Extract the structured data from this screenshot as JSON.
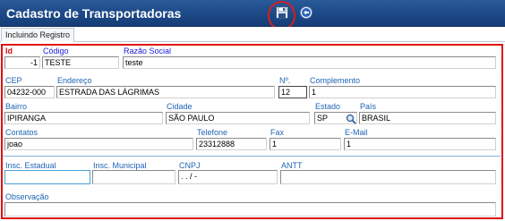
{
  "window": {
    "title": "Cadastro de Transportadoras",
    "save_icon": "save-disk-icon",
    "back_icon": "back-arrow-icon",
    "accent_color": "#1d4a88",
    "highlight_color": "#e01010"
  },
  "tab": {
    "label": "Incluindo Registro"
  },
  "form": {
    "id": {
      "label": "Id",
      "value": "-1"
    },
    "codigo": {
      "label": "Código",
      "value": "TESTE"
    },
    "razao_social": {
      "label": "Razão Social",
      "value": "teste"
    },
    "cep": {
      "label": "CEP",
      "value": "04232-000"
    },
    "endereco": {
      "label": "Endereço",
      "value": "ESTRADA DAS LÁGRIMAS"
    },
    "numero": {
      "label": "Nº.",
      "value": "12"
    },
    "complemento": {
      "label": "Complemento",
      "value": "1"
    },
    "bairro": {
      "label": "Bairro",
      "value": "IPIRANGA"
    },
    "cidade": {
      "label": "Cidade",
      "value": "SÃO PAULO"
    },
    "estado": {
      "label": "Estado",
      "value": "SP"
    },
    "pais": {
      "label": "País",
      "value": "BRASIL"
    },
    "contatos": {
      "label": "Contatos",
      "value": "joao"
    },
    "telefone": {
      "label": "Telefone",
      "value": "23312888"
    },
    "fax": {
      "label": "Fax",
      "value": "1"
    },
    "email": {
      "label": "E-Mail",
      "value": "1"
    },
    "insc_estadual": {
      "label": "Insc. Estadual",
      "value": ""
    },
    "insc_municipal": {
      "label": "Insc. Municipal",
      "value": ""
    },
    "cnpj": {
      "label": "CNPJ",
      "value": " .  .   /    -"
    },
    "antt": {
      "label": "ANTT",
      "value": ""
    },
    "observacao": {
      "label": "Observação",
      "value": ""
    }
  }
}
